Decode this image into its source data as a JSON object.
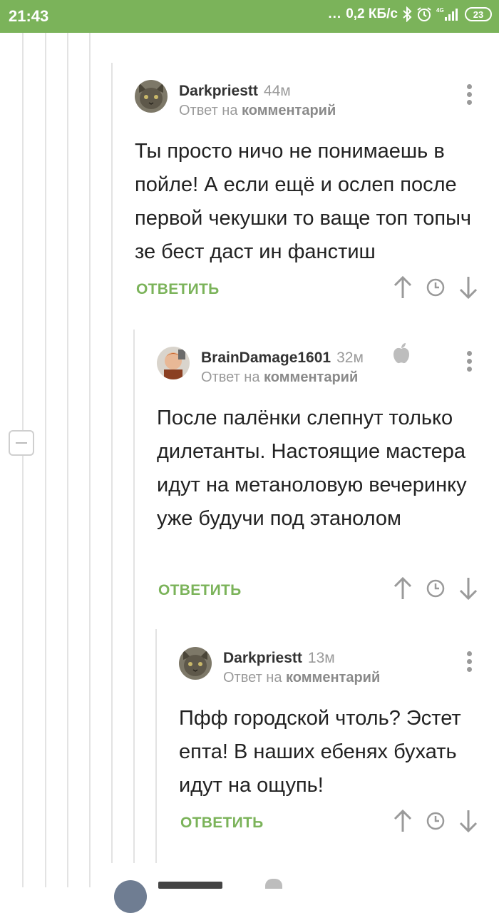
{
  "status_bar": {
    "time": "21:43",
    "network_speed": "0,2 КБ/с",
    "network_dots": "...",
    "signal_label": "4G",
    "battery": "23"
  },
  "comments": [
    {
      "author": "Darkpriestt",
      "time": "44м",
      "reply_prefix": "Ответ на",
      "reply_target": "комментарий",
      "text": "Ты просто ничо не понимаешь в пойле! А если ещё и ослеп после первой чекушки то ваще топ топыч зе бест даст ин фанстиш",
      "reply_label": "ОТВЕТИТЬ"
    },
    {
      "author": "BrainDamage1601",
      "time": "32м",
      "reply_prefix": "Ответ на",
      "reply_target": "комментарий",
      "text": "После палёнки слепнут только дилетанты. Настоящие мастера идут на метаноловую вечеринку уже будучи под этанолом",
      "reply_label": "ОТВЕТИТЬ"
    },
    {
      "author": "Darkpriestt",
      "time": "13м",
      "reply_prefix": "Ответ на",
      "reply_target": "комментарий",
      "text": "Пфф городской чтоль? Эстет епта! В наших ебенях бухать идут на ощупь!",
      "reply_label": "ОТВЕТИТЬ"
    }
  ],
  "colors": {
    "accent": "#7bb35a",
    "muted": "#9a9a9a",
    "thread_line": "#e3e3e3"
  }
}
